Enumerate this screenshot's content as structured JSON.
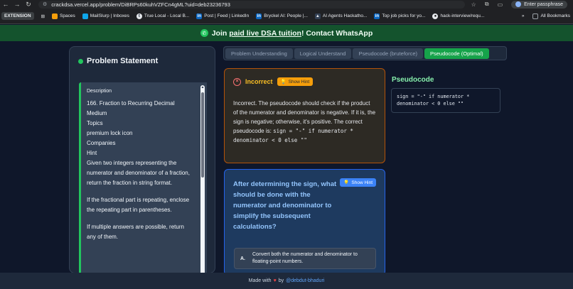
{
  "browser": {
    "url": "crackdsa.vercel.app/problem/DiBRPs60kuhVZFCn4gML?uid=deb23236793",
    "profile_label": "Enter passphrase",
    "bookmarks": [
      {
        "label": "EXTENSION",
        "icon": "extension-icon"
      },
      {
        "label": "Spaces",
        "icon": "folder-icon"
      },
      {
        "label": "MailSlurp | Inboxes",
        "icon": "mail-icon"
      },
      {
        "label": "True Local - Local B...",
        "icon": "true-local-icon"
      },
      {
        "label": "Post | Feed | LinkedIn",
        "icon": "linkedin-icon"
      },
      {
        "label": "Bryckel AI: People |...",
        "icon": "linkedin-icon"
      },
      {
        "label": "AI Agents Hackatho...",
        "icon": "hackathon-icon"
      },
      {
        "label": "Top job picks for yo...",
        "icon": "linkedin-icon"
      },
      {
        "label": "hack-interview/requ...",
        "icon": "github-icon"
      }
    ],
    "all_bookmarks": "All Bookmarks"
  },
  "banner": {
    "prefix": "Join ",
    "link": "paid live DSA tuition",
    "suffix": "! Contact WhatsApp"
  },
  "problem": {
    "title": "Problem Statement",
    "lines": [
      "Description",
      "166. Fraction to Recurring Decimal",
      "Medium",
      "Topics",
      "premium lock icon",
      "Companies",
      "Hint",
      "Given two integers representing the numerator and denominator of a fraction, return the fraction in string format.",
      "If the fractional part is repeating, enclose the repeating part in parentheses.",
      "If multiple answers are possible, return any of them."
    ]
  },
  "tabs": [
    {
      "label": "Problem Understanding",
      "active": false
    },
    {
      "label": "Logical Understand",
      "active": false
    },
    {
      "label": "Pseudocode (bruteforce)",
      "active": false
    },
    {
      "label": "Pseudocode (Optimal)",
      "active": true
    }
  ],
  "feedback": {
    "title": "Incorrect",
    "hint_label": "Show Hint",
    "body": "Incorrect. The pseudocode should check if the product of the numerator and denominator is negative. If it is, the sign is negative; otherwise, it's positive. The correct pseudocode is:",
    "code": "sign = \"-\" if numerator * denominator < 0 else \"\""
  },
  "question": {
    "text": "After determining the sign, what should be done with the numerator and denominator to simplify the subsequent calculations?",
    "hint_label": "Show Hint",
    "options": [
      {
        "letter": "A.",
        "text": "Convert both the numerator and denominator to floating-point numbers."
      }
    ]
  },
  "pseudocode": {
    "title": "Pseudocode",
    "code": "sign = \"-\" if numerator * denominator < 0 else \"\""
  },
  "footer": {
    "prefix": "Made with",
    "by": "by",
    "handle": "@debdut-bhaduri"
  },
  "colors": {
    "accent_green": "#16a34a",
    "warning_amber": "#f59e0b",
    "info_blue": "#3b82f6"
  }
}
